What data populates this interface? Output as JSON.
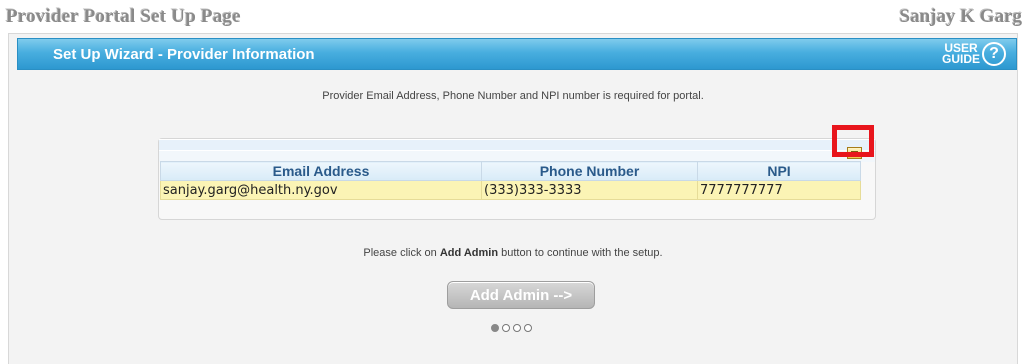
{
  "page": {
    "title": "Provider Portal Set Up Page",
    "user_name": "Sanjay K Garg"
  },
  "wizard": {
    "title": "Set Up Wizard - Provider Information",
    "user_guide_line1": "USER",
    "user_guide_line2": "GUIDE",
    "help_symbol": "?",
    "info_text": "Provider Email Address, Phone Number and NPI number is required for portal.",
    "continue_text_before": "Please click on ",
    "continue_text_bold": "Add Admin",
    "continue_text_after": " button to continue with the setup.",
    "add_admin_label": "Add Admin -->",
    "steps_total": 4,
    "current_step": 1
  },
  "provider_table": {
    "columns": [
      "Email Address",
      "Phone Number",
      "NPI"
    ],
    "rows": [
      [
        "sanjay.garg@health.ny.gov",
        "(333)333-3333",
        "7777777777"
      ]
    ],
    "edit_icon": "edit-icon"
  },
  "colors": {
    "header_blue": "#3aa3d8",
    "highlight_red": "#e8151c",
    "row_yellow": "#fbf4b5"
  }
}
